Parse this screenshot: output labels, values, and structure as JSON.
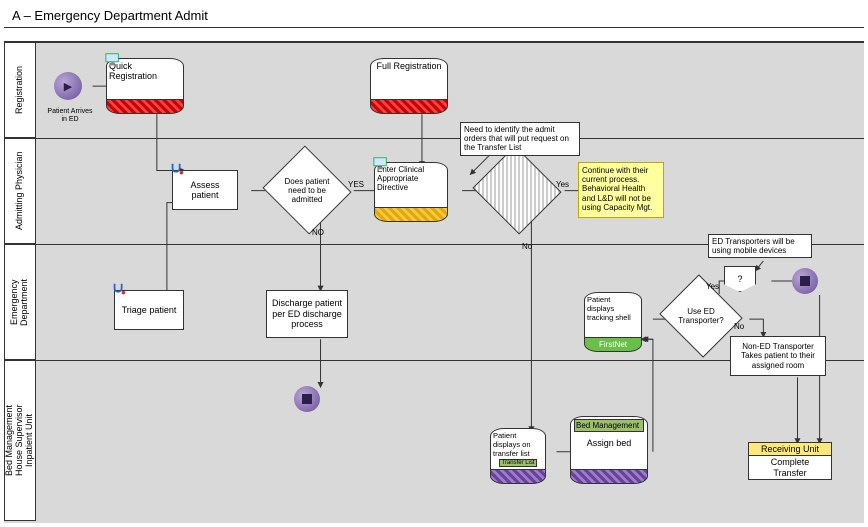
{
  "title": "A – Emergency Department Admit",
  "lanes": {
    "registration": "Registration",
    "physician": "Admitting Physician",
    "emergency": "Emergency\nDepartment",
    "bed": "Bed Management\nHouse Supervisor\nInpatient Unit"
  },
  "nodes": {
    "start_label": "Patient\nArrives in ED",
    "quick_reg": "Quick Registration",
    "full_reg": "Full Registration",
    "assess": "Assess patient",
    "decision_admit": "Does patient\nneed to be\nadmitted",
    "enter_directive": "Enter Clinical\nAppropriate\nDirective",
    "hatched_decision": "",
    "continue_note": "Continue with their current process. Behavioral Health and L&D will not be using Capacity Mgt.",
    "admit_orders_callout": "Need to identify the admit orders that will put request on the Transfer List",
    "triage": "Triage patient",
    "discharge": "Discharge patient per ED discharge process",
    "tracking_shell_hdr": "Patient displays tracking shell",
    "tracking_shell_app": "FirstNet",
    "use_transporter": "Use ED\nTransporter?",
    "flag_label": "?",
    "transport_callout": "ED Transporters will be using mobile devices",
    "non_ed_transport": "Non-ED Transporter\nTakes patient to\ntheir assigned room",
    "transfer_list_txt": "Patient\ndisplays on\ntransfer list",
    "transfer_list_app": "Transfer List",
    "bed_mgmt_hdr": "Bed Management",
    "assign_bed": "Assign bed",
    "receiving_hdr": "Receiving Unit",
    "complete_transfer": "Complete Transfer"
  },
  "edges": {
    "yes1": "YES",
    "no1": "NO",
    "yes2": "Yes",
    "no2": "No",
    "yes3": "Yes",
    "no3": "No"
  },
  "icons": {
    "computer": "computer-icon",
    "stethoscope": "stethoscope-icon",
    "play": "play-icon"
  }
}
